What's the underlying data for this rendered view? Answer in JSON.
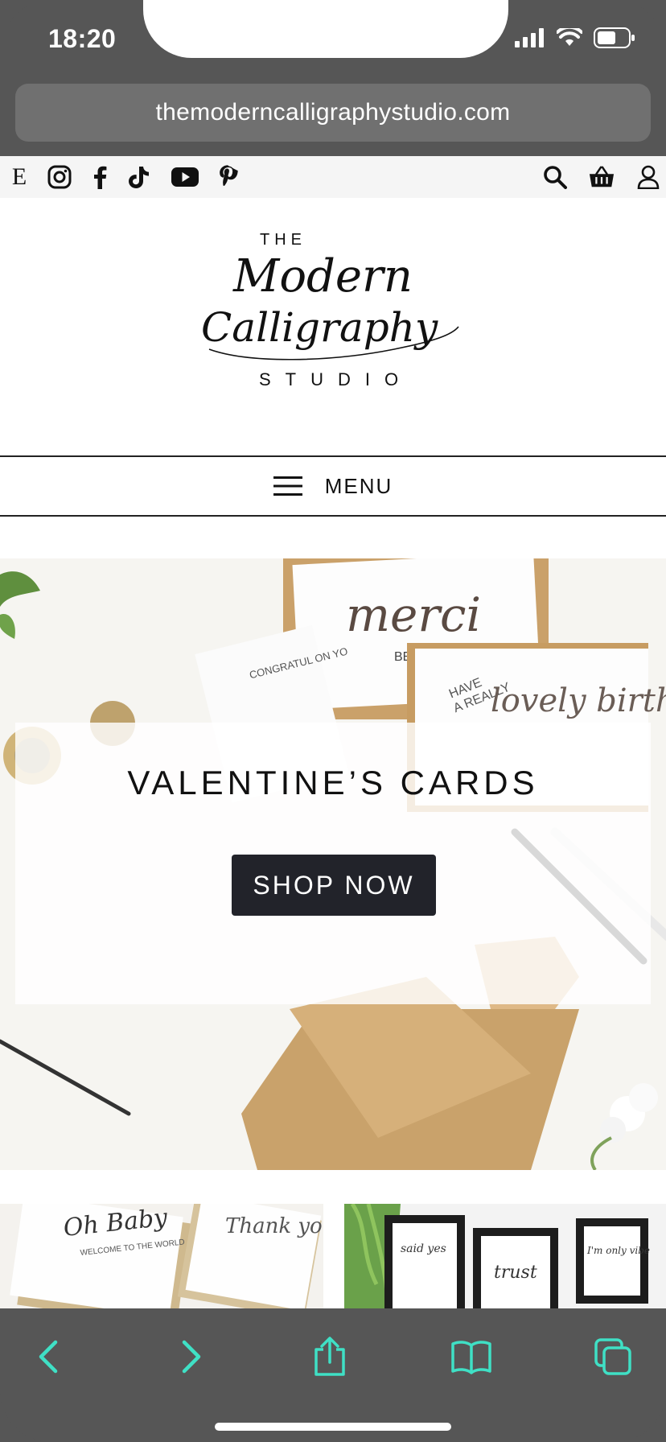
{
  "status_bar": {
    "time": "18:20",
    "icons": [
      "signal-icon",
      "wifi-icon",
      "battery-icon"
    ]
  },
  "browser": {
    "url": "themoderncalligraphystudio.com"
  },
  "social_bar": {
    "left_icons": [
      "etsy-icon",
      "instagram-icon",
      "facebook-icon",
      "tiktok-icon",
      "youtube-icon",
      "pinterest-icon"
    ],
    "right_icons": [
      "search-icon",
      "basket-icon",
      "user-icon"
    ],
    "etsy_letter": "E"
  },
  "logo": {
    "the": "THE",
    "modern": "Modern",
    "calligraphy": "Calligraphy",
    "studio": "STUDIO"
  },
  "menu": {
    "label": "MENU"
  },
  "hero": {
    "title": "VALENTINE’S CARDS",
    "button_label": "SHOP NOW",
    "card_merci": "merci",
    "card_beaucoup": "BEAUCOUP",
    "card_have": "HAVE",
    "card_really": "A REALLY",
    "card_birthday": "lovely birthday",
    "card_congrat": "CONGRATUL ON YO"
  },
  "thumbnails": {
    "left_text_1": "Oh Baby",
    "left_text_2": "WELCOME TO THE WORLD",
    "left_text_3": "Thank you",
    "right_frame_1": "said yes",
    "right_frame_2": "trust",
    "right_frame_3": "I'm only vibe"
  },
  "toolbar": {
    "icons": [
      "back-icon",
      "forward-icon",
      "share-icon",
      "bookmarks-icon",
      "tabs-icon"
    ]
  },
  "colors": {
    "chrome": "#565656",
    "accent": "#3fe0c5",
    "button": "#22232a"
  }
}
